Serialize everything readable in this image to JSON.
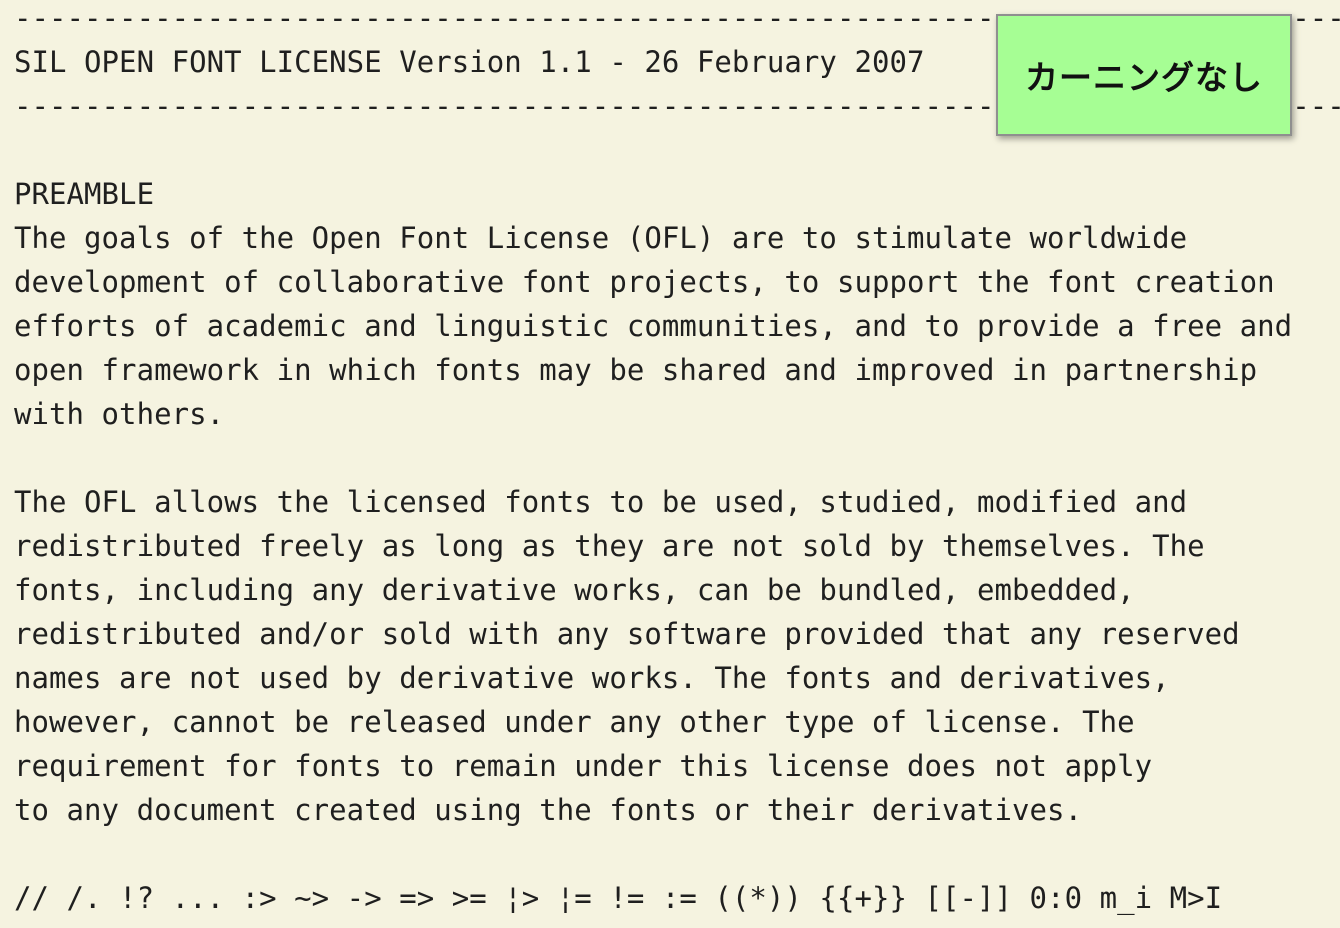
{
  "document": {
    "lines": [
      "----------------------------------------------------------------------------",
      "SIL OPEN FONT LICENSE Version 1.1 - 26 February 2007",
      "----------------------------------------------------------------------------",
      "",
      "PREAMBLE",
      "The goals of the Open Font License (OFL) are to stimulate worldwide",
      "development of collaborative font projects, to support the font creation",
      "efforts of academic and linguistic communities, and to provide a free and",
      "open framework in which fonts may be shared and improved in partnership",
      "with others.",
      "",
      "The OFL allows the licensed fonts to be used, studied, modified and",
      "redistributed freely as long as they are not sold by themselves. The",
      "fonts, including any derivative works, can be bundled, embedded,",
      "redistributed and/or sold with any software provided that any reserved",
      "names are not used by derivative works. The fonts and derivatives,",
      "however, cannot be released under any other type of license. The",
      "requirement for fonts to remain under this license does not apply",
      "to any document created using the fonts or their derivatives.",
      "",
      "// /. !? ... :> ~> -> => >= ¦> ¦= != := ((*)) {{+}} [[-]] 0:0 m_i M>I"
    ]
  },
  "badge": {
    "label": "カーニングなし"
  },
  "colors": {
    "background": "#f5f3e0",
    "text": "#1f1f1f",
    "badge_background": "#a6fe94",
    "badge_border": "#8f8f8f"
  }
}
